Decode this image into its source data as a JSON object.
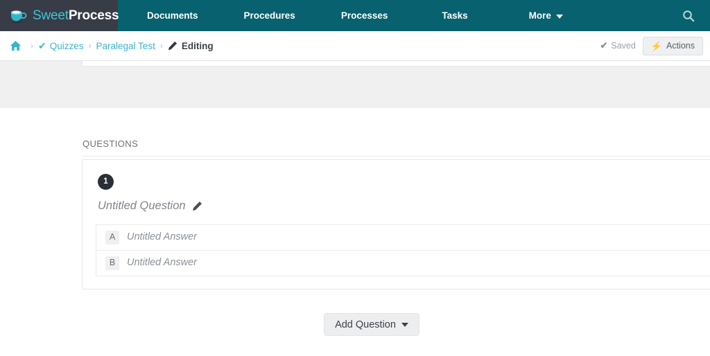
{
  "navbar": {
    "brand": {
      "word1": "Sweet",
      "word2": "Process",
      "icon": "coffee-cup-icon"
    },
    "links": [
      {
        "id": "documents",
        "label": "Documents"
      },
      {
        "id": "procedures",
        "label": "Procedures"
      },
      {
        "id": "processes",
        "label": "Processes"
      },
      {
        "id": "tasks",
        "label": "Tasks"
      },
      {
        "id": "more",
        "label": "More",
        "has_caret": true
      }
    ],
    "search_icon": "search-icon",
    "background_color": "#07616e",
    "brand_background_color": "#383c46"
  },
  "breadcrumb": {
    "home_icon": "home-icon",
    "separator": "›",
    "items": [
      {
        "label": "Quizzes",
        "icon": "check-icon",
        "link": true
      },
      {
        "label": "Paralegal Test",
        "link": true
      },
      {
        "label": "Editing",
        "icon": "pencil-icon",
        "link": false
      }
    ],
    "saved_label": "Saved",
    "saved_check": "✔",
    "actions_label": "Actions",
    "actions_icon": "lightning-bolt-icon",
    "link_color": "#3ab5cc"
  },
  "main": {
    "section_heading": "QUESTIONS",
    "question": {
      "number": "1",
      "title": "Untitled Question",
      "edit_icon": "pencil-icon",
      "answers": [
        {
          "letter": "A",
          "text": "Untitled Answer"
        },
        {
          "letter": "B",
          "text": "Untitled Answer"
        }
      ]
    },
    "add_question_label": "Add Question",
    "add_question_caret": "caret-down-icon"
  }
}
